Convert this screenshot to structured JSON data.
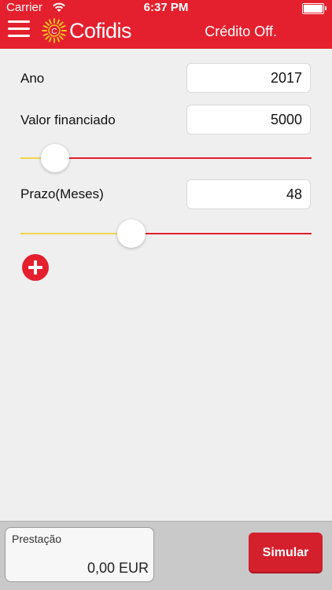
{
  "status": {
    "carrier": "Carrier",
    "time": "6:37 PM"
  },
  "header": {
    "brand": "Cofidis",
    "logo_letter": "C",
    "title": "Crédito Off."
  },
  "form": {
    "year": {
      "label": "Ano",
      "value": "2017"
    },
    "amount": {
      "label": "Valor financiado",
      "value": "5000",
      "slider_fraction": 0.12
    },
    "term": {
      "label": "Prazo(Meses)",
      "value": "48",
      "slider_fraction": 0.38
    }
  },
  "footer": {
    "result_label": "Prestação",
    "result_value": "0,00 EUR",
    "simulate_label": "Simular"
  },
  "colors": {
    "brand_red": "#e4202e",
    "slider_fill": "#f1d54a"
  }
}
